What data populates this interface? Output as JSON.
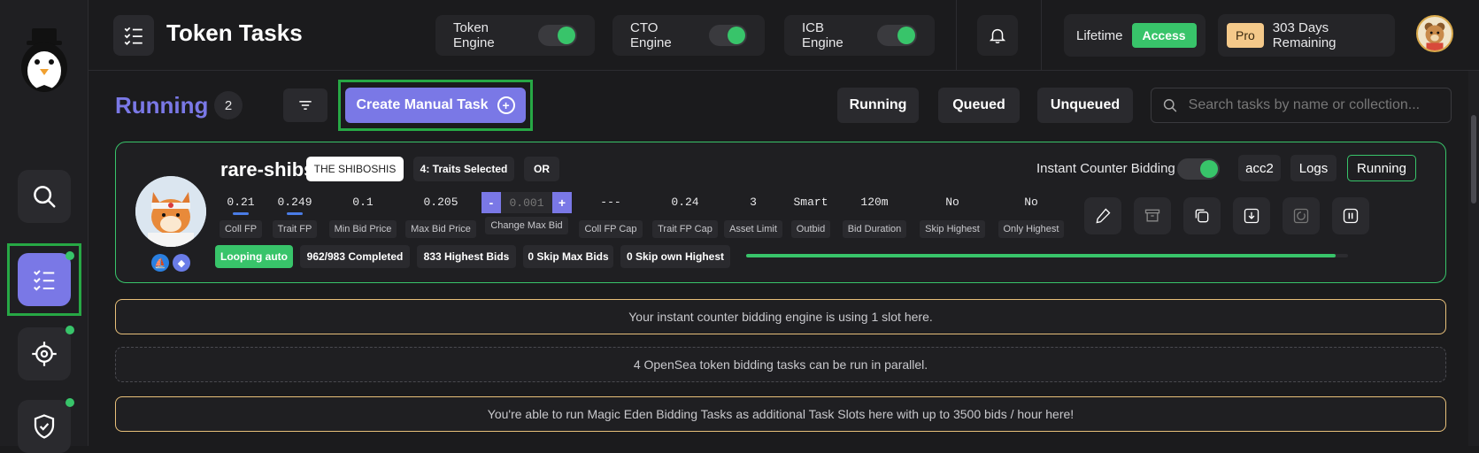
{
  "app": {
    "title": "Token Tasks"
  },
  "engines": [
    {
      "label": "Token Engine",
      "enabled": true
    },
    {
      "label": "CTO Engine",
      "enabled": true
    },
    {
      "label": "ICB Engine",
      "enabled": true
    }
  ],
  "plan": {
    "lifetime_label": "Lifetime",
    "access_label": "Access",
    "pro_label": "Pro",
    "remaining": "303 Days Remaining"
  },
  "sidebar": {
    "items": [
      {
        "name": "search",
        "active": false,
        "dot": false
      },
      {
        "name": "tasks",
        "active": true,
        "dot": true
      },
      {
        "name": "target",
        "active": false,
        "dot": true
      },
      {
        "name": "shield",
        "active": false,
        "dot": true
      }
    ]
  },
  "toolbar": {
    "section_title": "Running",
    "count": "2",
    "create_label": "Create Manual Task",
    "tabs": [
      "Running",
      "Queued",
      "Unqueued"
    ],
    "search_placeholder": "Search tasks by name or collection..."
  },
  "task": {
    "name": "rare-shibs",
    "collection": "THE SHIBOSHIS",
    "traits": "4: Traits Selected",
    "logic": "OR",
    "icb_label": "Instant Counter Bidding",
    "icb_enabled": true,
    "account": "acc2",
    "logs_label": "Logs",
    "status": "Running",
    "stats": [
      {
        "value": "0.21",
        "label": "Coll FP",
        "underline": true
      },
      {
        "value": "0.249",
        "label": "Trait FP",
        "underline": true
      },
      {
        "value": "0.1",
        "label": "Min Bid Price",
        "underline": false
      },
      {
        "value": "0.205",
        "label": "Max Bid Price",
        "underline": false
      },
      {
        "value": "0.001",
        "label": "Change Max Bid",
        "stepper": true
      },
      {
        "value": "---",
        "label": "Coll FP Cap",
        "underline": false
      },
      {
        "value": "0.24",
        "label": "Trait FP Cap",
        "underline": false
      },
      {
        "value": "3",
        "label": "Asset Limit",
        "underline": false
      },
      {
        "value": "Smart",
        "label": "Outbid",
        "underline": false
      },
      {
        "value": "120m",
        "label": "Bid Duration",
        "underline": false
      },
      {
        "value": "No",
        "label": "Skip Highest",
        "underline": false
      },
      {
        "value": "No",
        "label": "Only Highest",
        "underline": false
      }
    ],
    "stepper_minus": "-",
    "stepper_plus": "+",
    "statuses": [
      "Looping auto",
      "962/983 Completed",
      "833 Highest Bids",
      "0 Skip Max Bids",
      "0 Skip own Highest"
    ],
    "progress": 0.98,
    "actions": [
      "edit-icon",
      "archive-icon",
      "duplicate-icon",
      "download-icon",
      "refresh-icon",
      "pause-icon"
    ]
  },
  "notices": [
    "Your instant counter bidding engine is using 1 slot here.",
    "4 OpenSea token bidding tasks can be run in parallel.",
    "You're able to run Magic Eden Bidding Tasks as additional Task Slots here with up to 3500 bids / hour here!"
  ],
  "colors": {
    "accent": "#7a78e6",
    "green": "#38c46a",
    "gold": "#e8c07a"
  }
}
